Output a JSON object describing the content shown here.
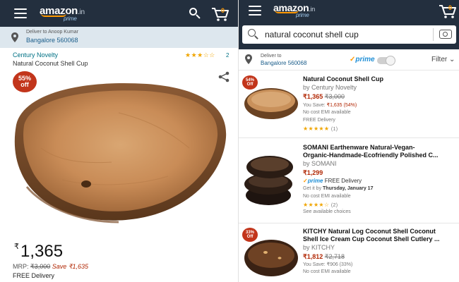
{
  "left": {
    "logo_text": "amazon",
    "logo_suffix": ".in",
    "logo_prime": "prime",
    "cart_count": "0",
    "deliver_to_line": "Deliver to Anoop Kumar",
    "deliver_location": "Bangalore 560068",
    "brand": "Century Novelty",
    "product_title": "Natural Coconut Shell Cup",
    "rating_stars": "★★★☆☆",
    "rating_count": "2",
    "discount_badge_pct": "55%",
    "discount_badge_label": "off",
    "price_symbol": "₹",
    "price": "1,365",
    "mrp_label": "MRP:",
    "mrp_value": "₹3,000",
    "save_text": "Save ₹1,635",
    "free_delivery": "FREE Delivery"
  },
  "right": {
    "logo_text": "amazon",
    "logo_suffix": ".in",
    "logo_prime": "prime",
    "cart_count": "0",
    "search_query": "natural coconut shell cup",
    "deliver_to": "Deliver to",
    "deliver_location": "Bangalore 560068",
    "prime_label": "prime",
    "filter_label": "Filter",
    "results": [
      {
        "title": "Natural Coconut Shell Cup",
        "by": "by Century Novelty",
        "price": "₹1,365",
        "mrp": "₹3,000",
        "you_save_label": "You Save: ",
        "you_save_value": "₹1,635 (54%)",
        "line1": "No cost EMI available",
        "line2": "FREE Delivery",
        "stars": "★★★★★",
        "rating_count": "(1)",
        "badge_pct": "54%",
        "badge_label": "Off"
      },
      {
        "title1": "SOMANI Earthenware Natural-Vegan-",
        "title2": "Organic-Handmade-Ecofriendly Polished C...",
        "by": "by SOMANI",
        "price": "₹1,299",
        "prime_text": "prime",
        "free_delivery": " FREE Delivery",
        "get_it_prefix": "Get it by ",
        "get_it_date": "Thursday, January 17",
        "line1": "No cost EMI available",
        "stars": "★★★★☆",
        "rating_count": "(2)",
        "see_choices": "See available choices"
      },
      {
        "title1": "KITCHY Natural Log Coconut Shell Coconut",
        "title2": "Shell Ice Cream Cup Coconut Shell Cutlery ...",
        "by": "by KITCHY",
        "price": "₹1,812",
        "mrp": "₹2,718",
        "you_save_label": "You Save: ",
        "you_save_value": "₹906 (33%)",
        "line1": "No cost EMI available",
        "badge_pct": "33%",
        "badge_label": "Off"
      }
    ]
  },
  "colors": {
    "header_bg": "#232f3e",
    "deliver_bg": "#dde7ee",
    "accent_orange": "#ff9900",
    "price_red": "#b12704",
    "badge_red": "#c2351b",
    "link_teal": "#007185",
    "prime_blue": "#1f8fd6"
  }
}
